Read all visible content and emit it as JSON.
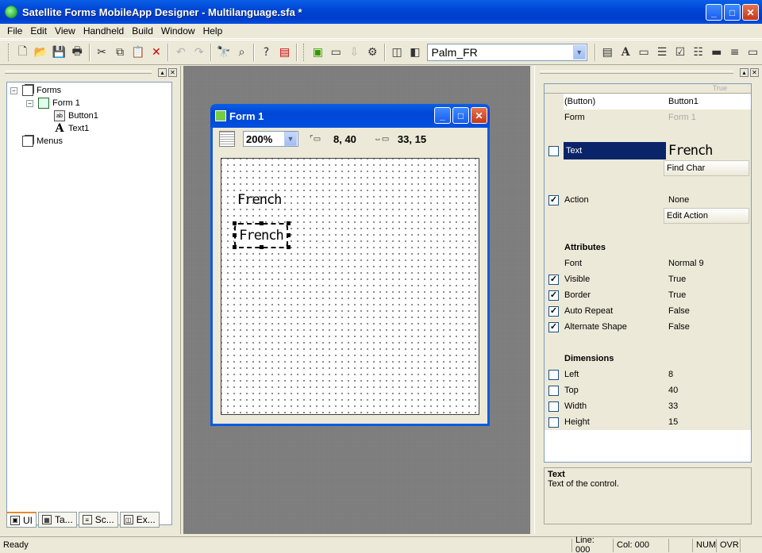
{
  "window": {
    "title": "Satellite Forms MobileApp Designer - Multilanguage.sfa *"
  },
  "menu": [
    "File",
    "Edit",
    "View",
    "Handheld",
    "Build",
    "Window",
    "Help"
  ],
  "toolbar": {
    "platform": "Palm_FR"
  },
  "tree": {
    "forms": "Forms",
    "form1": "Form 1",
    "button1": "Button1",
    "text1": "Text1",
    "menus": "Menus"
  },
  "tabs": [
    "UI",
    "Ta...",
    "Sc...",
    "Ex..."
  ],
  "form_window": {
    "title": "Form 1",
    "zoom": "200%",
    "position": "8, 40",
    "size": "33, 15",
    "text_label": "French",
    "button_label": "French"
  },
  "properties": {
    "header_hint": "True",
    "type": "(Button)",
    "name": "Button1",
    "form_label": "Form",
    "form_value": "Form 1",
    "text_label": "Text",
    "text_value": "French",
    "find_char": "Find Char",
    "action_label": "Action",
    "action_value": "None",
    "edit_action": "Edit Action",
    "attributes_header": "Attributes",
    "font_label": "Font",
    "font_value": "Normal  9",
    "visible_label": "Visible",
    "visible_value": "True",
    "border_label": "Border",
    "border_value": "True",
    "autorepeat_label": "Auto Repeat",
    "autorepeat_value": "False",
    "altshape_label": "Alternate Shape",
    "altshape_value": "False",
    "dimensions_header": "Dimensions",
    "left_label": "Left",
    "left_value": "8",
    "top_label": "Top",
    "top_value": "40",
    "width_label": "Width",
    "width_value": "33",
    "height_label": "Height",
    "height_value": "15"
  },
  "description": {
    "title": "Text",
    "body": "Text of the control."
  },
  "status": {
    "ready": "Ready",
    "line": "Line: 000",
    "col": "Col: 000",
    "num": "NUM",
    "ovr": "OVR"
  }
}
